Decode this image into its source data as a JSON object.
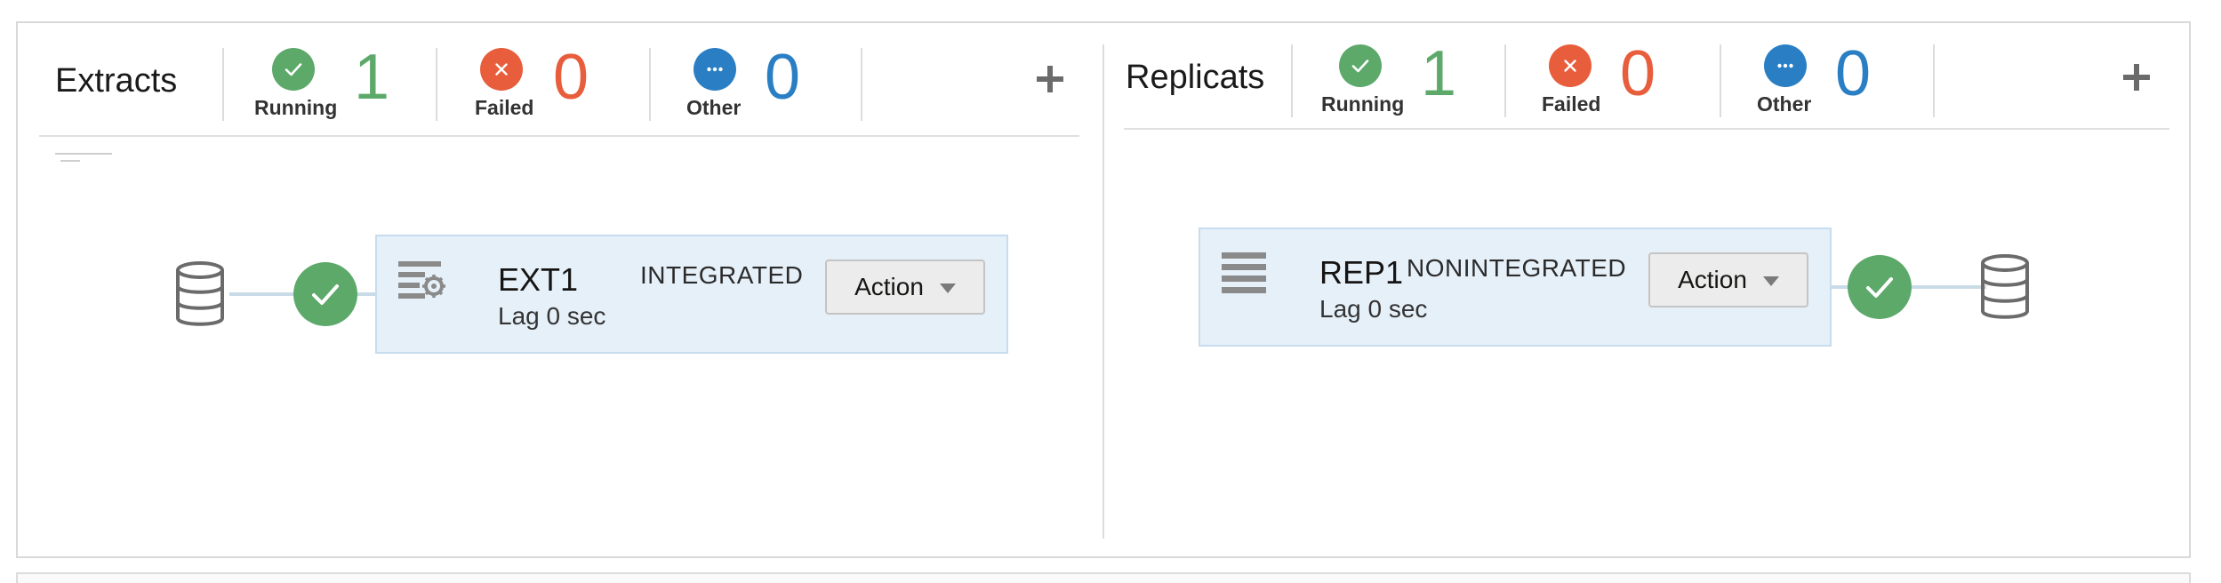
{
  "colors": {
    "running": "#5ca96a",
    "failed": "#e85d3c",
    "other": "#2a7fc4",
    "card_bg": "#e6f0f9",
    "card_border": "#c6dcef"
  },
  "extracts": {
    "title": "Extracts",
    "stats": [
      {
        "key": "running",
        "label": "Running",
        "count": "1",
        "icon": "check-icon"
      },
      {
        "key": "failed",
        "label": "Failed",
        "count": "0",
        "icon": "close-icon"
      },
      {
        "key": "other",
        "label": "Other",
        "count": "0",
        "icon": "more-icon"
      }
    ],
    "add_icon": "plus-icon",
    "process": {
      "name": "EXT1",
      "type": "INTEGRATED",
      "lag": "Lag 0 sec",
      "icon": "extract-gear-icon",
      "action_label": "Action",
      "status": "running"
    }
  },
  "replicats": {
    "title": "Replicats",
    "stats": [
      {
        "key": "running",
        "label": "Running",
        "count": "1",
        "icon": "check-icon"
      },
      {
        "key": "failed",
        "label": "Failed",
        "count": "0",
        "icon": "close-icon"
      },
      {
        "key": "other",
        "label": "Other",
        "count": "0",
        "icon": "more-icon"
      }
    ],
    "add_icon": "plus-icon",
    "process": {
      "name": "REP1",
      "type": "NONINTEGRATED",
      "lag": "Lag 0 sec",
      "icon": "replicat-list-icon",
      "action_label": "Action",
      "status": "running"
    }
  }
}
